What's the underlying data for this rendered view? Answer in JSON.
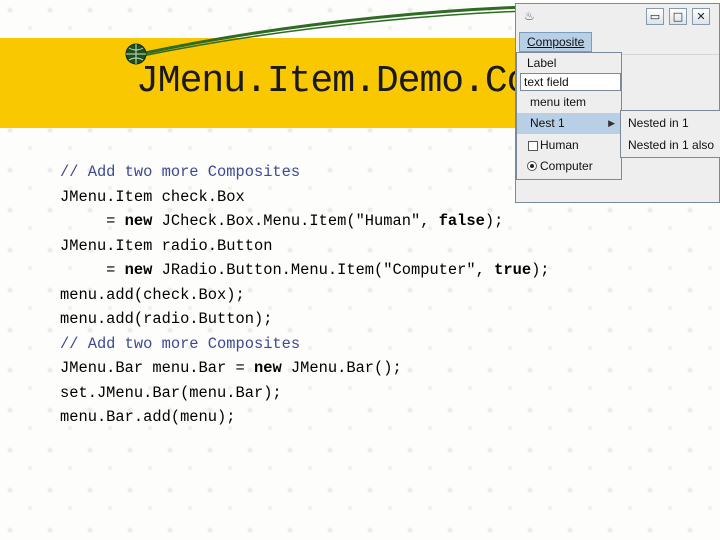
{
  "slide": {
    "title": "JMenu.Item.Demo.Composite"
  },
  "code_lines": [
    [
      {
        "t": "// Add two more Composites",
        "c": "cm"
      }
    ],
    [
      {
        "t": "JMenu.Item check.Box"
      }
    ],
    [
      {
        "t": "     = "
      },
      {
        "t": "new",
        "c": "kw"
      },
      {
        "t": " JCheck.Box.Menu.Item(\"Human\", "
      },
      {
        "t": "false",
        "c": "kw"
      },
      {
        "t": ");"
      }
    ],
    [
      {
        "t": "JMenu.Item radio.Button"
      }
    ],
    [
      {
        "t": "     = "
      },
      {
        "t": "new",
        "c": "kw"
      },
      {
        "t": " JRadio.Button.Menu.Item(\"Computer\", "
      },
      {
        "t": "true",
        "c": "kw"
      },
      {
        "t": ");"
      }
    ],
    [
      {
        "t": "menu.add(check.Box);"
      }
    ],
    [
      {
        "t": "menu.add(radio.Button);"
      }
    ],
    [
      {
        "t": "// Add two more Composites",
        "c": "cm"
      }
    ],
    [
      {
        "t": "JMenu.Bar menu.Bar = "
      },
      {
        "t": "new",
        "c": "kw"
      },
      {
        "t": " JMenu.Bar();"
      }
    ],
    [
      {
        "t": "set.JMenu.Bar(menu.Bar);"
      }
    ],
    [
      {
        "t": "menu.Bar.add(menu);"
      }
    ]
  ],
  "window": {
    "icon": "java-cup-icon",
    "controls": {
      "minimize": "▭",
      "maximize": "□",
      "close": "✕"
    },
    "menu_title": "Composite",
    "items": {
      "label": "Label",
      "text_field": "text field",
      "menu_item": "menu item",
      "nest": "Nest 1",
      "human": "Human",
      "computer": "Computer"
    },
    "submenu": [
      "Nested in 1",
      "Nested in 1 also"
    ]
  },
  "colors": {
    "title_band": "#f9c800",
    "swoosh": "#2f6b24",
    "menu_selection": "#b8cfe5",
    "comment": "#3d4a93"
  }
}
